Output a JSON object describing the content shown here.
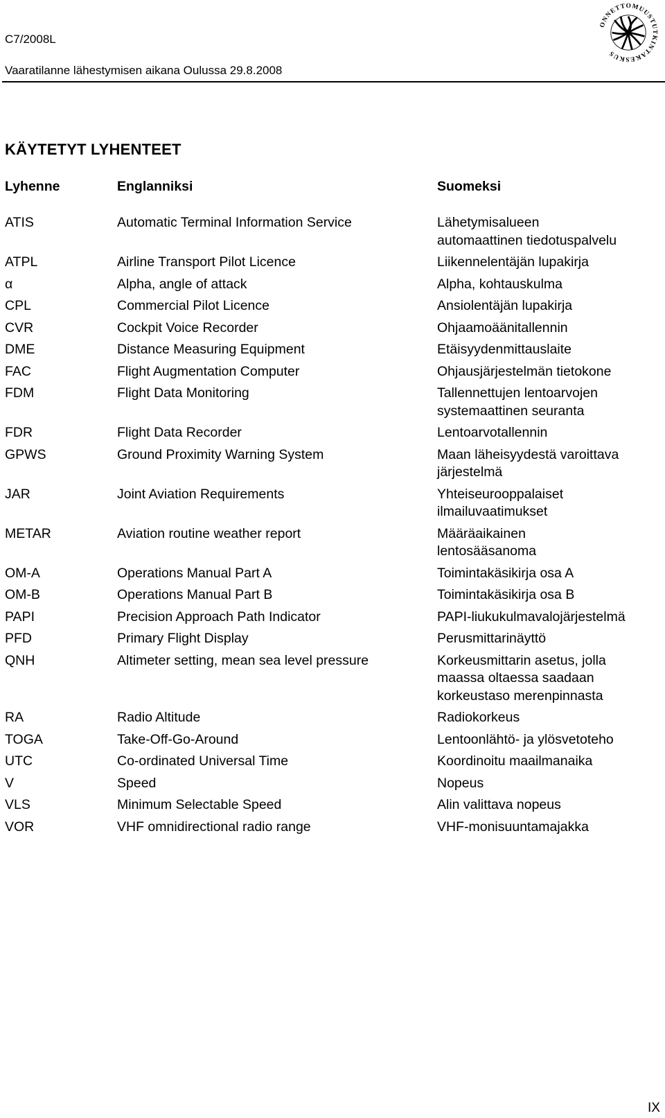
{
  "header": {
    "report_id": "C7/2008L",
    "report_title": "Vaaratilanne lähestymisen aikana Oulussa 29.8.2008",
    "logo_text": "ONNETTOMUUSTUTKINTAKESKUS"
  },
  "section_title": "KÄYTETYT LYHENTEET",
  "columns": {
    "abbr": "Lyhenne",
    "english": "Englanniksi",
    "finnish": "Suomeksi"
  },
  "rows": [
    {
      "abbr": "ATIS",
      "english": "Automatic Terminal Information Service",
      "finnish": "Lähetymisalueen\nautomaattinen tiedotuspalvelu"
    },
    {
      "abbr": "ATPL",
      "english": "Airline Transport Pilot Licence",
      "finnish": "Liikennelentäjän lupakirja"
    },
    {
      "abbr": "α",
      "english": "Alpha, angle of attack",
      "finnish": "Alpha, kohtauskulma"
    },
    {
      "abbr": "CPL",
      "english": "Commercial Pilot Licence",
      "finnish": "Ansiolentäjän lupakirja"
    },
    {
      "abbr": "CVR",
      "english": "Cockpit Voice Recorder",
      "finnish": "Ohjaamoäänitallennin"
    },
    {
      "abbr": "DME",
      "english": "Distance Measuring Equipment",
      "finnish": "Etäisyydenmittauslaite"
    },
    {
      "abbr": "FAC",
      "english": "Flight Augmentation Computer",
      "finnish": "Ohjausjärjestelmän tietokone"
    },
    {
      "abbr": "FDM",
      "english": "Flight Data Monitoring",
      "finnish": "Tallennettujen lentoarvojen\nsystemaattinen seuranta"
    },
    {
      "abbr": "FDR",
      "english": "Flight Data Recorder",
      "finnish": "Lentoarvotallennin"
    },
    {
      "abbr": "GPWS",
      "english": "Ground Proximity Warning System",
      "finnish": "Maan läheisyydestä varoittava\njärjestelmä"
    },
    {
      "abbr": "JAR",
      "english": "Joint Aviation Requirements",
      "finnish": "Yhteiseurooppalaiset\nilmailuvaatimukset"
    },
    {
      "abbr": "METAR",
      "english": "Aviation routine weather report",
      "finnish": "Määräaikainen\nlentosääsanoma"
    },
    {
      "abbr": "OM-A",
      "english": "Operations Manual Part A",
      "finnish": "Toimintakäsikirja osa A"
    },
    {
      "abbr": "OM-B",
      "english": "Operations Manual Part B",
      "finnish": "Toimintakäsikirja osa B"
    },
    {
      "abbr": "PAPI",
      "english": "Precision Approach Path Indicator",
      "finnish": "PAPI-liukukulmavalojärjestelmä"
    },
    {
      "abbr": "PFD",
      "english": "Primary Flight Display",
      "finnish": "Perusmittarinäyttö"
    },
    {
      "abbr": "QNH",
      "english": "Altimeter setting, mean sea level pressure",
      "finnish": "Korkeusmittarin asetus, jolla\nmaassa oltaessa saadaan\nkorkeustaso merenpinnasta"
    },
    {
      "abbr": "RA",
      "english": "Radio Altitude",
      "finnish": "Radiokorkeus"
    },
    {
      "abbr": "TOGA",
      "english": "Take-Off-Go-Around",
      "finnish": "Lentoonlähtö- ja ylösvetoteho"
    },
    {
      "abbr": "UTC",
      "english": "Co-ordinated Universal Time",
      "finnish": "Koordinoitu maailmanaika"
    },
    {
      "abbr": "V",
      "english": "Speed",
      "finnish": "Nopeus"
    },
    {
      "abbr": "VLS",
      "english": "Minimum Selectable Speed",
      "finnish": "Alin valittava nopeus"
    },
    {
      "abbr": "VOR",
      "english": "VHF omnidirectional radio range",
      "finnish": "VHF-monisuuntamajakka"
    }
  ],
  "footer": {
    "page_number": "IX"
  }
}
